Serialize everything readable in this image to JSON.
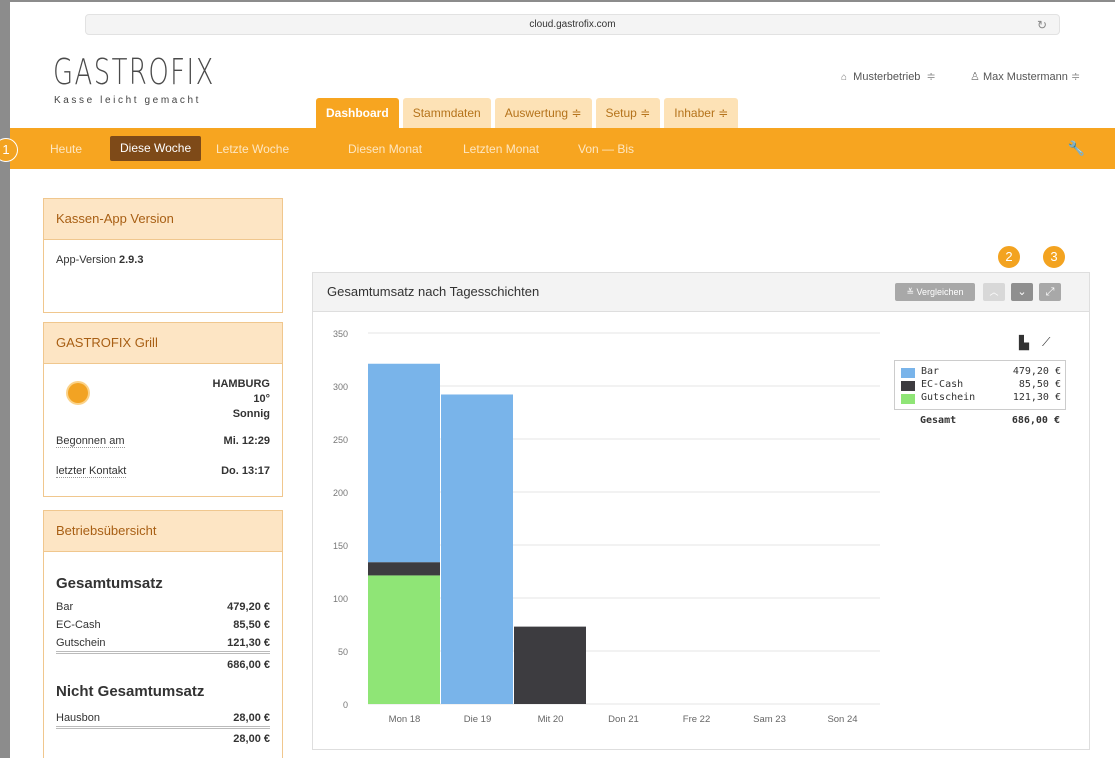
{
  "browser": {
    "url": "cloud.gastrofix.com",
    "reload_icon": "reload-icon"
  },
  "header": {
    "logo": "GASTROFIX",
    "tagline": "Kasse leicht gemacht",
    "business": "Musterbetrieb",
    "user": "Max Mustermann",
    "business_icon": "home-icon",
    "user_icon": "user-icon"
  },
  "nav": {
    "tabs": [
      {
        "label": "Dashboard"
      },
      {
        "label": "Stammdaten"
      },
      {
        "label": "Auswertung ≑"
      },
      {
        "label": "Setup ≑"
      },
      {
        "label": "Inhaber ≑"
      }
    ]
  },
  "subnav": {
    "items": [
      {
        "label": "Heute"
      },
      {
        "label": "Diese Woche"
      },
      {
        "label": "Letzte Woche"
      },
      {
        "label": "Diesen Monat"
      },
      {
        "label": "Letzten Monat"
      },
      {
        "label": "Von — Bis"
      }
    ],
    "selected": "Diese Woche"
  },
  "badges": {
    "b1": "1",
    "b2": "2",
    "b3": "3"
  },
  "version_card": {
    "title": "Kassen-App Version",
    "label": "App-Version",
    "value": "2.9.3"
  },
  "grill_card": {
    "title": "GASTROFIX Grill",
    "city": "HAMBURG",
    "temp": "10°",
    "weather": "Sonnig",
    "started_label": "Begonnen am",
    "started_value": "Mi. 12:29",
    "contact_label": "letzter Kontakt",
    "contact_value": "Do. 13:17"
  },
  "overview_card": {
    "title": "Betriebsübersicht",
    "gesamt_title": "Gesamtumsatz",
    "rows": [
      {
        "label": "Bar",
        "value": "479,20 €"
      },
      {
        "label": "EC-Cash",
        "value": "85,50 €"
      },
      {
        "label": "Gutschein",
        "value": "121,30 €"
      }
    ],
    "gesamt_total": "686,00 €",
    "nicht_title": "Nicht Gesamtumsatz",
    "nicht_rows": [
      {
        "label": "Hausbon",
        "value": "28,00 €"
      }
    ],
    "nicht_total": "28,00 €"
  },
  "panel": {
    "title": "Gesamtumsatz nach Tagesschichten",
    "compare_label": "≚ Vergleichen"
  },
  "legend": {
    "rows": [
      {
        "name": "Bar",
        "value": "479,20 €"
      },
      {
        "name": "EC-Cash",
        "value": "85,50 €"
      },
      {
        "name": "Gutschein",
        "value": "121,30 €"
      }
    ],
    "total_label": "Gesamt",
    "total_value": "686,00 €"
  },
  "chart_data": {
    "type": "bar",
    "stacked": true,
    "categories": [
      "Mon 18",
      "Die 19",
      "Mit 20",
      "Don 21",
      "Fre 22",
      "Sam 23",
      "Son 24"
    ],
    "series": [
      {
        "name": "Gutschein",
        "color": "#8fe576",
        "values": [
          121.3,
          0,
          0,
          0,
          0,
          0,
          0
        ]
      },
      {
        "name": "EC-Cash",
        "color": "#3d3c40",
        "values": [
          12.5,
          0,
          73,
          0,
          0,
          0,
          0
        ]
      },
      {
        "name": "Bar",
        "color": "#79b4ea",
        "values": [
          187.2,
          292,
          0,
          0,
          0,
          0,
          0
        ]
      }
    ],
    "ylim": [
      0,
      350
    ],
    "yticks": [
      0,
      50,
      100,
      150,
      200,
      250,
      300,
      350
    ],
    "grid": true,
    "legend_position": "top-right"
  }
}
